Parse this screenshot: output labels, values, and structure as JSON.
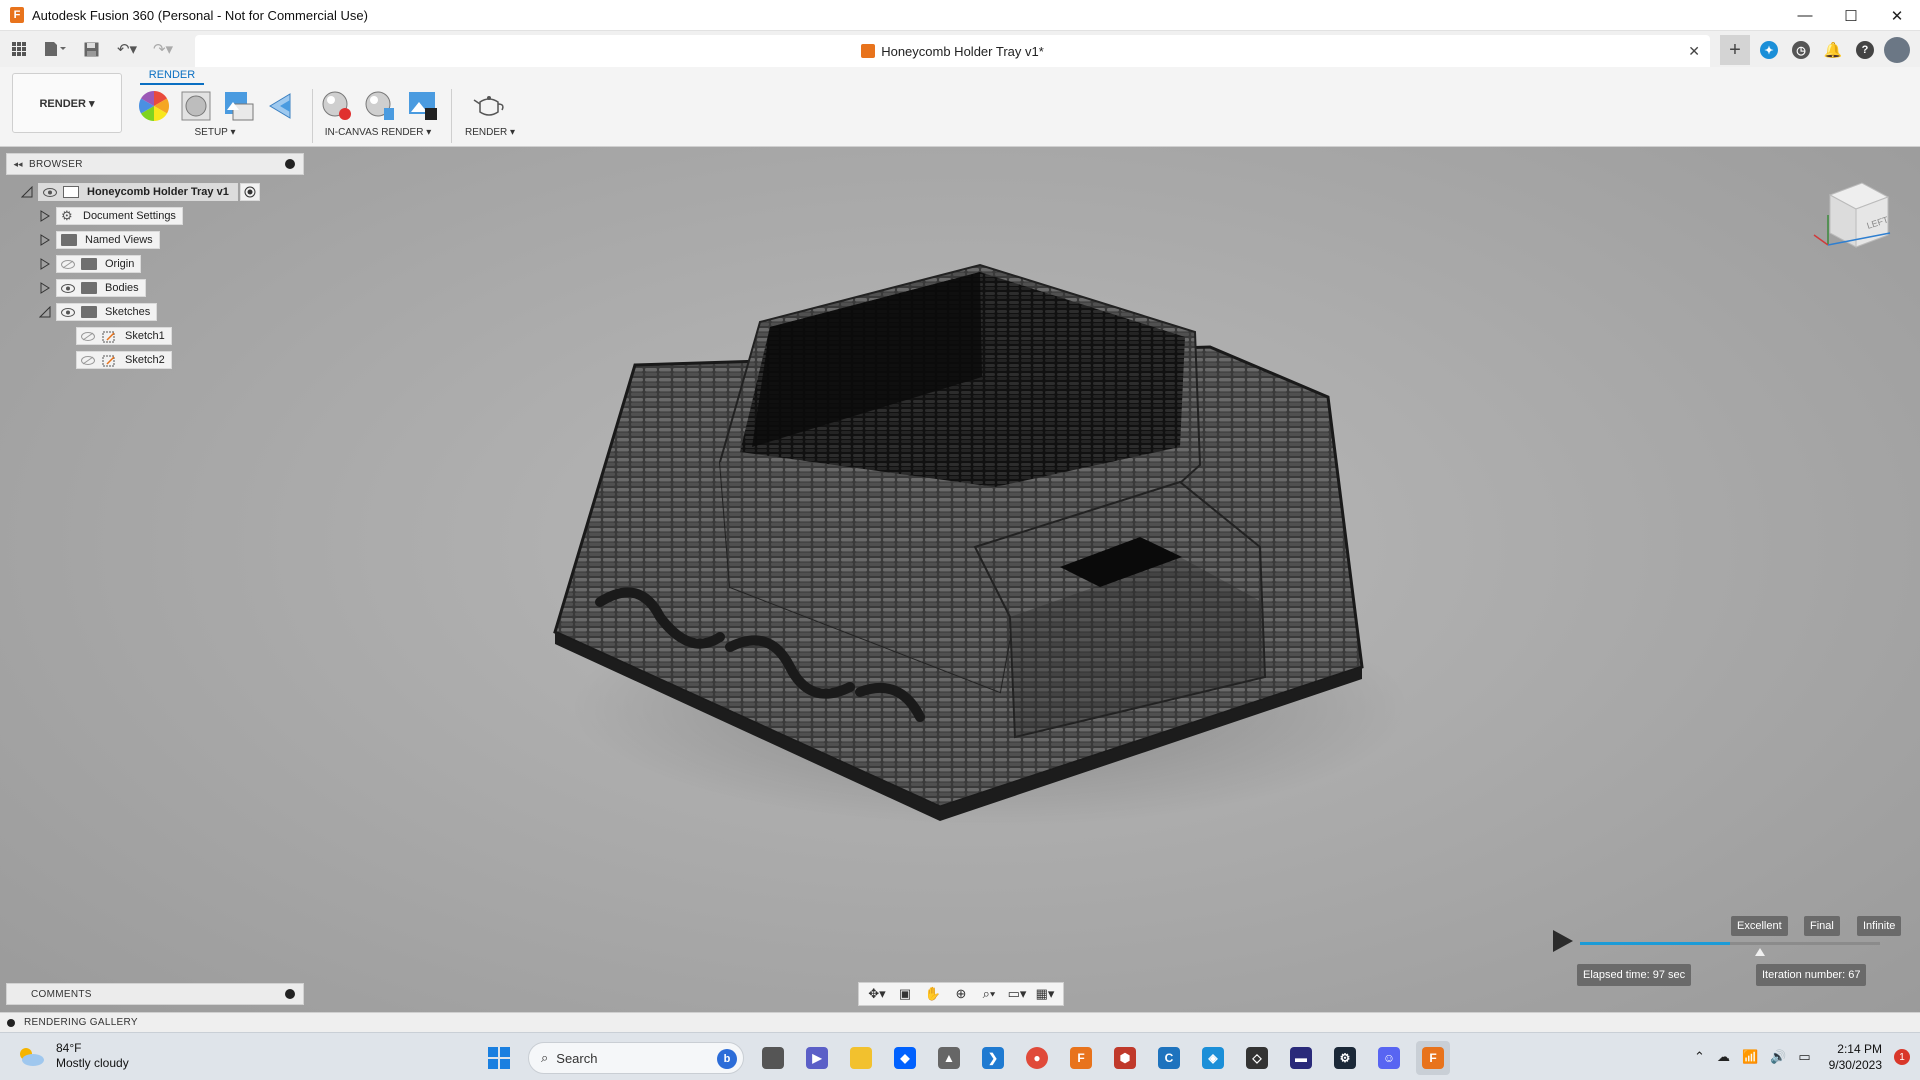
{
  "window": {
    "title": "Autodesk Fusion 360 (Personal - Not for Commercial Use)",
    "controls": [
      "—",
      "☐",
      "✕"
    ]
  },
  "document_tab": {
    "name": "Honeycomb Holder Tray v1*",
    "close": "✕"
  },
  "toolbar": {
    "workspace": "RENDER ▾",
    "active_tab": "RENDER",
    "groups": {
      "setup": "SETUP ▾",
      "in_canvas": "IN-CANVAS RENDER ▾",
      "render": "RENDER ▾"
    }
  },
  "browser": {
    "title": "BROWSER",
    "root": "Honeycomb Holder Tray v1",
    "items": [
      {
        "label": "Document Settings"
      },
      {
        "label": "Named Views"
      },
      {
        "label": "Origin"
      },
      {
        "label": "Bodies"
      },
      {
        "label": "Sketches"
      },
      {
        "label": "Sketch1"
      },
      {
        "label": "Sketch2"
      }
    ]
  },
  "viewcube": {
    "face": "LEFT"
  },
  "render_progress": {
    "quality_labels": [
      "Excellent",
      "Final",
      "Infinite"
    ],
    "progress": 0.5,
    "elapsed": "Elapsed time: 97 sec",
    "iteration": "Iteration number: 67"
  },
  "panels": {
    "comments": "COMMENTS",
    "gallery": "RENDERING GALLERY"
  },
  "taskbar": {
    "temperature": "84°F",
    "weather": "Mostly cloudy",
    "search_placeholder": "Search",
    "time": "2:14 PM",
    "date": "9/30/2023",
    "notifications": "1"
  },
  "colors": {
    "accent": "#0a6fc2",
    "fusion_orange": "#e8731c",
    "progress_fill": "#1b9bd7"
  }
}
